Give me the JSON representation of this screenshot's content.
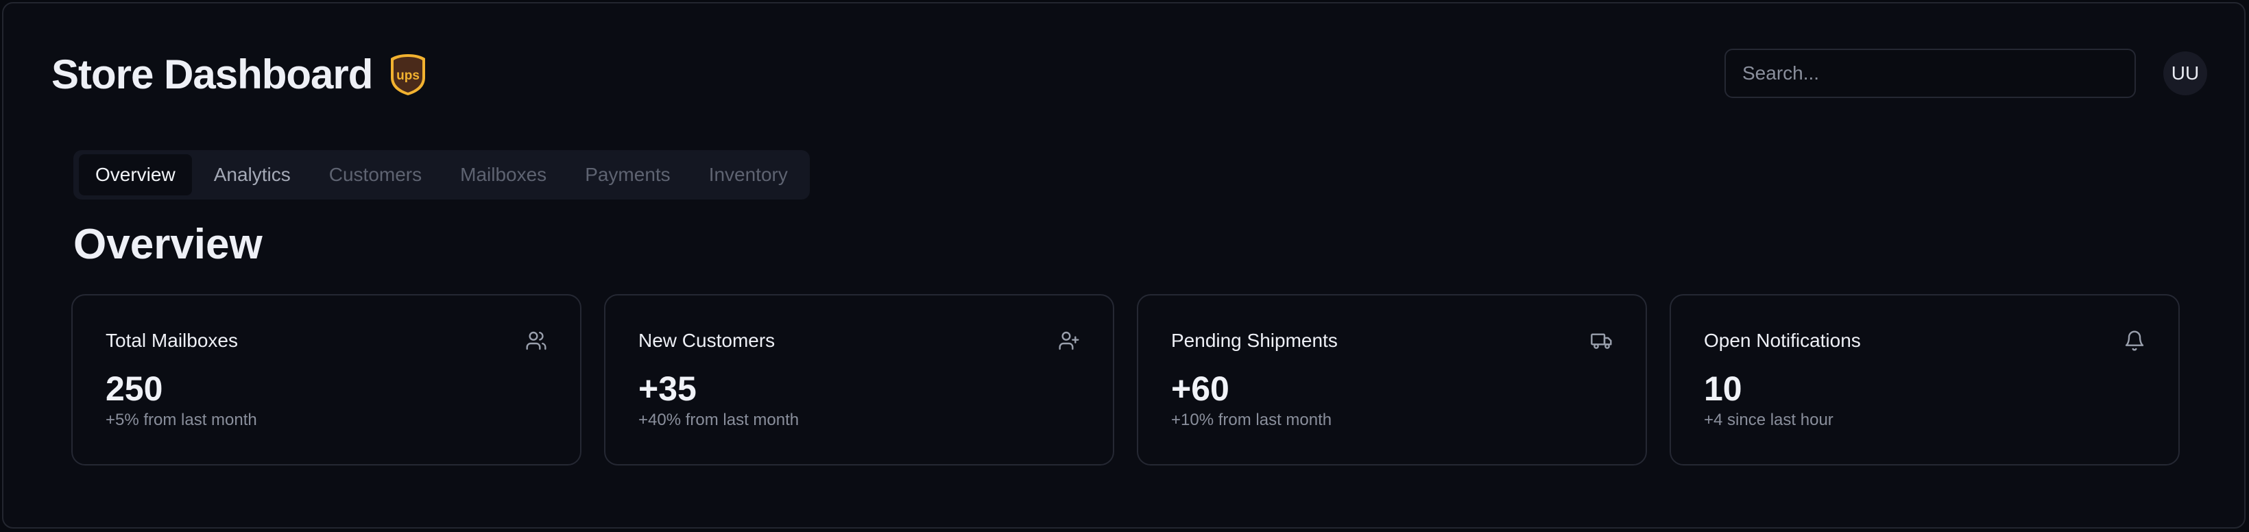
{
  "header": {
    "title": "Store Dashboard",
    "logo_text": "ups",
    "search_placeholder": "Search...",
    "avatar_initials": "UU"
  },
  "tabs": [
    {
      "label": "Overview",
      "active": true
    },
    {
      "label": "Analytics",
      "active": false
    },
    {
      "label": "Customers",
      "active": false
    },
    {
      "label": "Mailboxes",
      "active": false
    },
    {
      "label": "Payments",
      "active": false
    },
    {
      "label": "Inventory",
      "active": false
    }
  ],
  "section_title": "Overview",
  "cards": [
    {
      "label": "Total Mailboxes",
      "value": "250",
      "subtitle": "+5% from last month",
      "icon": "users-icon"
    },
    {
      "label": "New Customers",
      "value": "+35",
      "subtitle": "+40% from last month",
      "icon": "user-plus-icon"
    },
    {
      "label": "Pending Shipments",
      "value": "+60",
      "subtitle": "+10% from last month",
      "icon": "truck-icon"
    },
    {
      "label": "Open Notifications",
      "value": "10",
      "subtitle": "+4 since last hour",
      "icon": "bell-icon"
    }
  ],
  "colors": {
    "background": "#0a0c13",
    "border": "#252833",
    "text_primary": "#eef0f6",
    "text_muted": "#8a8f9c",
    "brand_gold": "#f2b230",
    "brand_brown": "#4a2a1a"
  }
}
